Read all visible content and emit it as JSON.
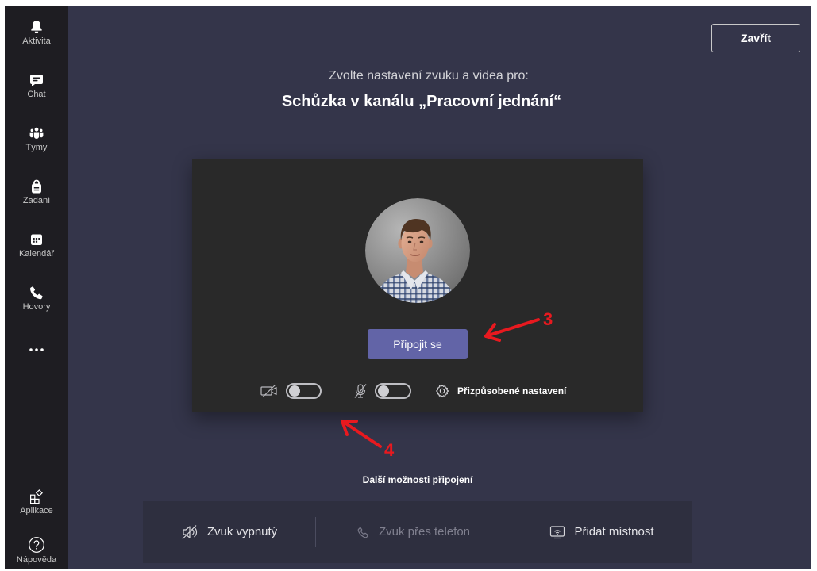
{
  "sidebar": {
    "items": [
      {
        "label": "Aktivita",
        "icon": "bell-icon"
      },
      {
        "label": "Chat",
        "icon": "chat-icon"
      },
      {
        "label": "Týmy",
        "icon": "teams-icon"
      },
      {
        "label": "Zadání",
        "icon": "assignments-icon"
      },
      {
        "label": "Kalendář",
        "icon": "calendar-icon"
      },
      {
        "label": "Hovory",
        "icon": "calls-icon"
      }
    ],
    "more": {
      "icon": "more-icon"
    },
    "bottom_items": [
      {
        "label": "Aplikace",
        "icon": "apps-icon"
      },
      {
        "label": "Nápověda",
        "icon": "help-icon"
      }
    ]
  },
  "header": {
    "close_label": "Zavřít"
  },
  "prejoin": {
    "subtitle": "Zvolte nastavení zvuku a videa pro:",
    "meeting_title": "Schůzka v kanálu „Pracovní jednání“",
    "join_label": "Připojit se",
    "camera": {
      "on": false,
      "icon": "video-off-icon"
    },
    "microphone": {
      "on": false,
      "icon": "mic-off-icon"
    },
    "custom_settings": {
      "label": "Přizpůsobené nastavení",
      "icon": "gear-icon"
    }
  },
  "other_options": {
    "heading": "Další možnosti připojení",
    "items": [
      {
        "label": "Zvuk vypnutý",
        "icon": "speaker-off-icon",
        "enabled": true
      },
      {
        "label": "Zvuk přes telefon",
        "icon": "phone-icon",
        "enabled": false
      },
      {
        "label": "Přidat místnost",
        "icon": "room-cast-icon",
        "enabled": true
      }
    ]
  },
  "annotations": [
    {
      "label": "3"
    },
    {
      "label": "4"
    }
  ],
  "colors": {
    "accent": "#6264a7",
    "annotation": "#e8191f",
    "app_bar": "#1e1d22",
    "stage": "#34354a",
    "preview_card": "#292929",
    "options_bar": "#2e2f3f",
    "disabled_text": "#80808f"
  }
}
